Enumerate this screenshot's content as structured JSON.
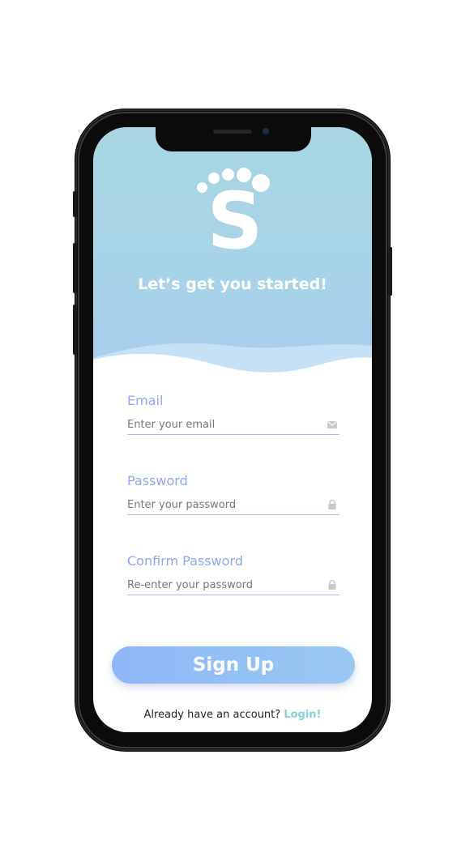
{
  "hero": {
    "logo_letter": "S",
    "title": "Let’s get you started!"
  },
  "form": {
    "email": {
      "label": "Email",
      "placeholder": "Enter your email",
      "icon": "envelope-icon"
    },
    "password": {
      "label": "Password",
      "placeholder": "Enter your password",
      "icon": "lock-icon"
    },
    "confirm_password": {
      "label": "Confirm Password",
      "placeholder": "Re-enter your password",
      "icon": "lock-icon"
    }
  },
  "actions": {
    "signup_label": "Sign Up",
    "login_prompt": "Already have an account?",
    "login_link": "Login!"
  },
  "colors": {
    "hero_top": "#a9d6e2",
    "label": "#8aa9ee",
    "underline": "#b3b7f5",
    "button_start": "#8fb6f7",
    "button_end": "#9bc8f1",
    "link": "#86d1d8"
  }
}
